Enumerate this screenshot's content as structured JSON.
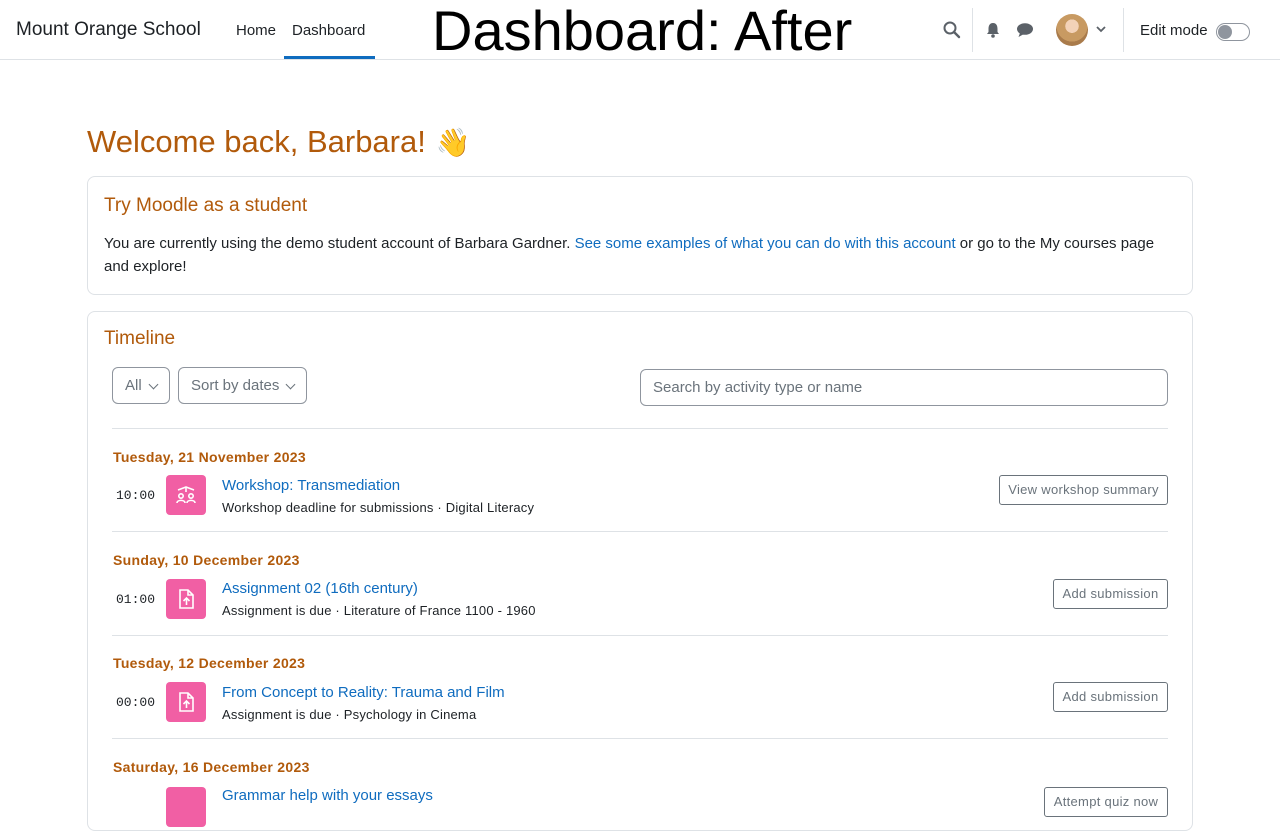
{
  "navbar": {
    "brand": "Mount Orange School",
    "links": [
      "Home",
      "Dashboard"
    ],
    "edit_mode_label": "Edit mode"
  },
  "overlay_title": "Dashboard: After",
  "welcome": {
    "text": "Welcome back, Barbara!",
    "emoji": "👋"
  },
  "try_moodle": {
    "title": "Try Moodle as a student",
    "text_before": "You are currently using the demo student account of Barbara Gardner. ",
    "link": "See some examples of what you can do with this account",
    "text_after": " or go to the My courses page and explore!"
  },
  "timeline": {
    "title": "Timeline",
    "filter_label": "All",
    "sort_label": "Sort by dates",
    "search_placeholder": "Search by activity type or name",
    "groups": [
      {
        "date": "Tuesday, 21 November 2023",
        "time": "10:00",
        "icon": "workshop-icon",
        "name": "Workshop: Transmediation",
        "meta": "Workshop deadline for submissions · Digital Literacy",
        "action": "View workshop summary"
      },
      {
        "date": "Sunday, 10 December 2023",
        "time": "01:00",
        "icon": "assignment-icon",
        "name": "Assignment 02 (16th century)",
        "meta": "Assignment is due · Literature of France 1100 - 1960",
        "action": "Add submission"
      },
      {
        "date": "Tuesday, 12 December 2023",
        "time": "00:00",
        "icon": "assignment-icon",
        "name": "From Concept to Reality: Trauma and Film",
        "meta": "Assignment is due · Psychology in Cinema",
        "action": "Add submission"
      },
      {
        "date": "Saturday, 16 December 2023",
        "time": "",
        "icon": "quiz-icon",
        "name": "Grammar help with your essays",
        "meta": "",
        "action": "Attempt quiz now"
      }
    ]
  },
  "colors": {
    "accent_orange": "#b15a0b",
    "link_blue": "#0f6cbf",
    "activity_pink": "#f15fa4"
  }
}
